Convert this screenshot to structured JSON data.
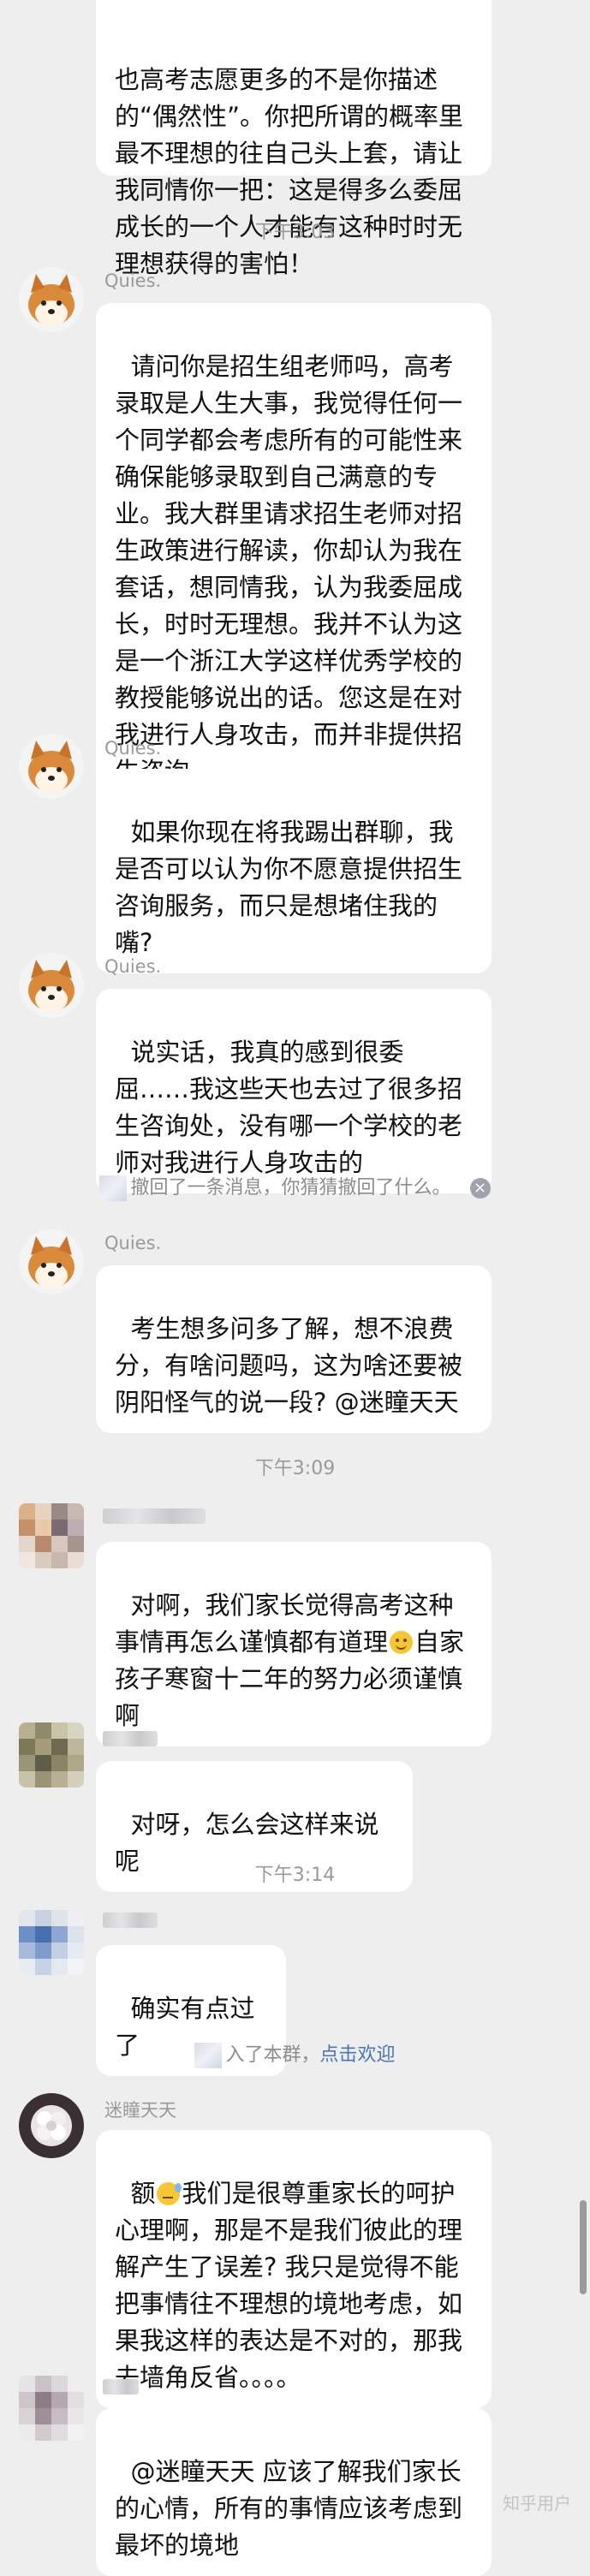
{
  "messages": {
    "m0": "也高考志愿更多的不是你描述的“偶然性”。你把所谓的概率里最不理想的往自己头上套，请让我同情你一把：这是得多么委屈成长的一个人才能有这种时时无理想获得的害怕！",
    "m1_sender": "Quies.",
    "m1": "请问你是招生组老师吗，高考录取是人生大事，我觉得任何一个同学都会考虑所有的可能性来确保能够录取到自己满意的专业。我大群里请求招生老师对招生政策进行解读，你却认为我在套话，想同情我，认为我委屈成长，时时无理想。我并不认为这是一个浙江大学这样优秀学校的教授能够说出的话。您这是在对我进行人身攻击，而并非提供招生咨询",
    "m2_sender": "Quies.",
    "m2": "如果你现在将我踢出群聊，我是否可以认为你不愿意提供招生咨询服务，而只是想堵住我的嘴?",
    "m3_sender": "Quies.",
    "m3": "说实话，我真的感到很委屈……我这些天也去过了很多招生咨询处，没有哪一个学校的老师对我进行人身攻击的",
    "m4_sender": "Quies.",
    "m4": "考生想多问多了解，想不浪费分，有啥问题吗，这为啥还要被阴阳怪气的说一段? @迷瞳天天",
    "m5_a": "对啊，我们家长觉得高考这种事情再怎么谨慎都有道理",
    "m5_b": "自家孩子寒窗十二年的努力必须谨慎啊",
    "m6": "对呀，怎么会这样来说呢",
    "m7": "确实有点过了",
    "m8_sender": "迷瞳天天",
    "m8_a": "额",
    "m8_b": "我们是很尊重家长的呵护心理啊，那是不是我们彼此的理解产生了误差? 我只是觉得不能把事情往不理想的境地考虑，如果我这样的表达是不对的，那我去墙角反省。。。。",
    "m9": "@迷瞳天天 应该了解我们家长的心情，所有的事情应该考虑到最坏的境地"
  },
  "times": {
    "t1": "下午3:03",
    "t2": "下午3:09",
    "t3": "下午3:14"
  },
  "notices": {
    "recall": "撤回了一条消息，你猜猜撤回了什么。",
    "join_text": "入了本群，",
    "join_link": "点击欢迎"
  },
  "watermark": "知乎用户",
  "icons": {
    "close": "close-icon",
    "smile": "smiley-emoji-icon",
    "sweat": "sweat-emoji-icon"
  }
}
